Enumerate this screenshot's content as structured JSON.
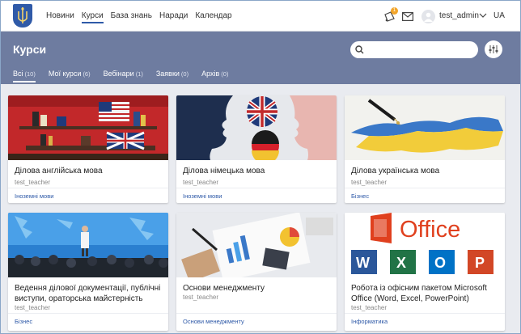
{
  "nav": {
    "items": [
      {
        "label": "Новини",
        "active": false
      },
      {
        "label": "Курси",
        "active": true
      },
      {
        "label": "База знань",
        "active": false
      },
      {
        "label": "Наради",
        "active": false
      },
      {
        "label": "Календар",
        "active": false
      }
    ]
  },
  "user": {
    "notifications": "1",
    "username": "test_admin",
    "language": "UA"
  },
  "page": {
    "title": "Курси",
    "search_placeholder": ""
  },
  "tabs": [
    {
      "label": "Всі",
      "count": "(10)",
      "active": true
    },
    {
      "label": "Мої курси",
      "count": "(6)",
      "active": false
    },
    {
      "label": "Вебінари",
      "count": "(1)",
      "active": false
    },
    {
      "label": "Заявки",
      "count": "(0)",
      "active": false
    },
    {
      "label": "Архів",
      "count": "(0)",
      "active": false
    }
  ],
  "courses": [
    {
      "title": "Ділова англійська мова",
      "teacher": "test_teacher",
      "category": "Іноземні мови"
    },
    {
      "title": "Ділова німецька мова",
      "teacher": "test_teacher",
      "category": "Іноземні мови"
    },
    {
      "title": "Ділова українська мова",
      "teacher": "test_teacher",
      "category": "Бізнес"
    },
    {
      "title": "Ведення ділової документації, публічні виступи, ораторська майстерність",
      "teacher": "test_teacher",
      "category": "Бізнес"
    },
    {
      "title": "Основи менеджменту",
      "teacher": "test_teacher",
      "category": "Основи менеджменту"
    },
    {
      "title": "Робота із офісним пакетом Microsoft Office (Word, Excel, PowerPoint)",
      "teacher": "test_teacher",
      "category": "Інформатика",
      "image_text": "Office"
    }
  ],
  "colors": {
    "accent": "#2f5aa8",
    "header": "#6e7ca0",
    "badge": "#f2a52a"
  }
}
